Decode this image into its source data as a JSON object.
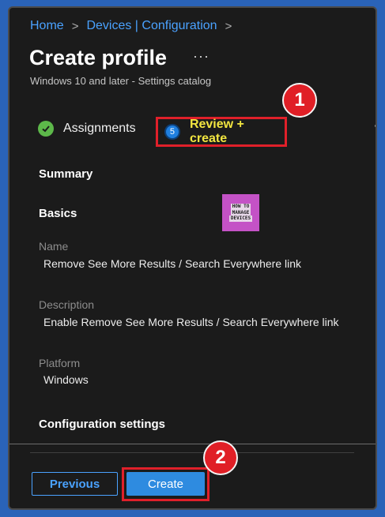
{
  "breadcrumb": {
    "home": "Home",
    "sep1": ">",
    "devices_config": "Devices | Configuration",
    "sep2": ">"
  },
  "page": {
    "title": "Create profile",
    "more": "···",
    "subtitle": "Windows 10 and later - Settings catalog"
  },
  "steps": {
    "assignments": {
      "label": "Assignments",
      "status": "complete"
    },
    "review": {
      "number": "5",
      "label": "Review + create"
    }
  },
  "annotations": {
    "badge1": "1",
    "badge2": "2",
    "highlight_color": "#e0202a"
  },
  "logo": {
    "line1": "HOW TO",
    "line2": "MANAGE",
    "line3": "DEVICES"
  },
  "summary": {
    "heading": "Summary",
    "basics_heading": "Basics",
    "name_label": "Name",
    "name_value": "Remove See More Results / Search Everywhere link",
    "description_label": "Description",
    "description_value": "Enable Remove See More Results / Search Everywhere link",
    "platform_label": "Platform",
    "platform_value": "Windows",
    "config_heading": "Configuration settings"
  },
  "footer": {
    "previous_label": "Previous",
    "create_label": "Create"
  },
  "colors": {
    "background": "#1b1b1b",
    "link": "#4aa2ff",
    "accent_button": "#2e8be0",
    "success": "#5db84a",
    "review_text": "#f2e640"
  }
}
